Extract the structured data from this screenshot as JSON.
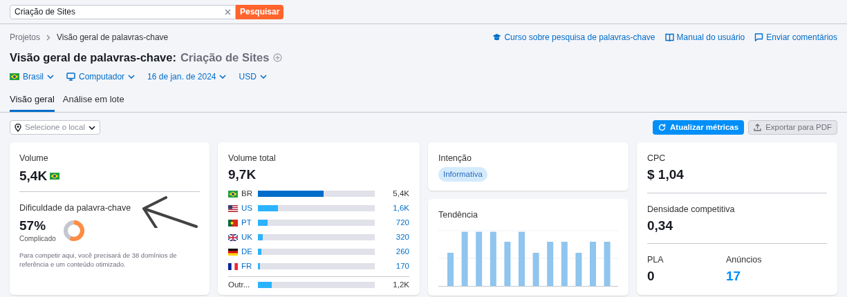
{
  "search": {
    "value": "Criação de Sites",
    "button": "Pesquisar"
  },
  "breadcrumbs": [
    "Projetos",
    "Visão geral de palavras-chave"
  ],
  "help_links": [
    {
      "label": "Curso sobre pesquisa de palavras-chave",
      "kind": "course"
    },
    {
      "label": "Manual do usuário",
      "kind": "manual"
    },
    {
      "label": "Enviar comentários",
      "kind": "feedback"
    }
  ],
  "title": {
    "main": "Visão geral de palavras-chave:",
    "keyword": "Criação de Sites"
  },
  "filters": [
    {
      "label": "Brasil",
      "kind": "country"
    },
    {
      "label": "Computador",
      "kind": "device"
    },
    {
      "label": "16 de jan. de 2024",
      "kind": "date"
    },
    {
      "label": "USD",
      "kind": "currency"
    }
  ],
  "tabs": [
    {
      "label": "Visão geral",
      "selected": true
    },
    {
      "label": "Análise em lote",
      "selected": false
    }
  ],
  "location": {
    "placeholder": "Selecione o local"
  },
  "actions": [
    {
      "label": "Atualizar métricas",
      "kind": "primary"
    },
    {
      "label": "Exportar para PDF",
      "kind": "secondary"
    }
  ],
  "volume": {
    "label": "Volume",
    "value": "5,4K"
  },
  "difficulty": {
    "label": "Dificuldade da palavra-chave",
    "value": "57%",
    "rating": "Complicado",
    "level": 0.57,
    "note": "Para competir aqui, você precisará de 38 domínios de referência e um conteúdo otimizado."
  },
  "total_volume": {
    "label": "Volume total",
    "value": "9,7K",
    "rows": [
      {
        "code": "BR",
        "value": "5,4K",
        "level": 0.56,
        "selected": true
      },
      {
        "code": "US",
        "value": "1,6K",
        "level": 0.17,
        "selected": false
      },
      {
        "code": "PT",
        "value": "720",
        "level": 0.08,
        "selected": false
      },
      {
        "code": "UK",
        "value": "320",
        "level": 0.04,
        "selected": false
      },
      {
        "code": "DE",
        "value": "260",
        "level": 0.03,
        "selected": false
      },
      {
        "code": "FR",
        "value": "170",
        "level": 0.02,
        "selected": false
      }
    ],
    "other": {
      "code": "Outr...",
      "value": "1,2K",
      "level": 0.12
    }
  },
  "intent": {
    "label": "Intenção",
    "badge": "Informativa"
  },
  "trend": {
    "label": "Tendência"
  },
  "cpc": {
    "label": "CPC",
    "value": "$ 1,04"
  },
  "density": {
    "label": "Densidade competitiva",
    "value": "0,34"
  },
  "pla": {
    "label": "PLA",
    "value": "0"
  },
  "ads": {
    "label": "Anúncios",
    "value": "17"
  }
}
